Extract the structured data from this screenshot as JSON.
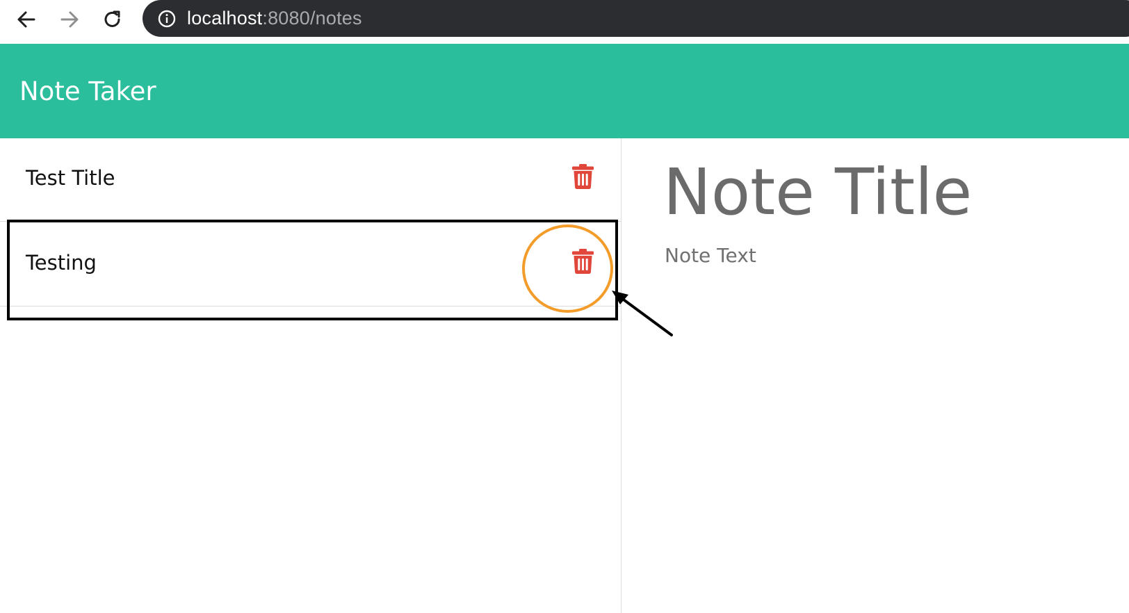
{
  "browser": {
    "url_host": "localhost",
    "url_rest": ":8080/notes",
    "icons": {
      "back": "back-arrow-icon",
      "forward": "forward-arrow-icon",
      "reload": "reload-icon",
      "site_info": "info-icon"
    }
  },
  "header": {
    "title": "Note Taker"
  },
  "notes": [
    {
      "title": "Test Title",
      "delete_icon": "trash-icon"
    },
    {
      "title": "Testing",
      "delete_icon": "trash-icon"
    }
  ],
  "editor": {
    "title_placeholder": "Note Title",
    "text_placeholder": "Note Text"
  },
  "colors": {
    "header_bg": "#2abe9c",
    "trash": "#e0473a",
    "annotation_circle": "#f39c2a",
    "address_bar": "#2b2d30"
  }
}
